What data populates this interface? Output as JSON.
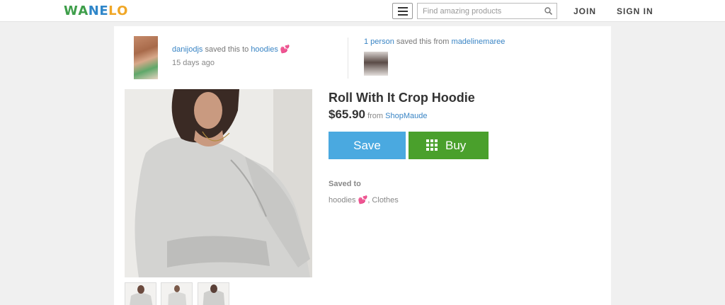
{
  "header": {
    "logo_letters": [
      {
        "ch": "W",
        "color": "#3e9e4a"
      },
      {
        "ch": "A",
        "color": "#3e9e4a"
      },
      {
        "ch": "N",
        "color": "#2f86c9"
      },
      {
        "ch": "E",
        "color": "#2f86c9"
      },
      {
        "ch": "L",
        "color": "#f0a727"
      },
      {
        "ch": "O",
        "color": "#f0a727"
      }
    ],
    "menu_icon": "hamburger-icon",
    "search_placeholder": "Find amazing products",
    "search_icon": "search-icon",
    "join_label": "JOIN",
    "signin_label": "SIGN IN"
  },
  "activity": {
    "saver_name": "danijodjs",
    "saved_text": "saved this to",
    "board_name": "hoodies",
    "heart": "💕",
    "time_ago": "15 days ago",
    "count_link": "1 person",
    "saved_from_text": "saved this from",
    "source_user": "madelinemaree"
  },
  "product": {
    "title": "Roll With It Crop Hoodie",
    "price": "$65.90",
    "from_text": "from",
    "store": "ShopMaude",
    "save_label": "Save",
    "buy_label": "Buy",
    "saved_to_heading": "Saved to",
    "boards_text": "hoodies",
    "boards_heart": "💕",
    "boards_rest": ", Clothes"
  },
  "colors": {
    "link": "#3a85c5",
    "save_button": "#4aa9e0",
    "buy_button": "#4aa02c"
  }
}
